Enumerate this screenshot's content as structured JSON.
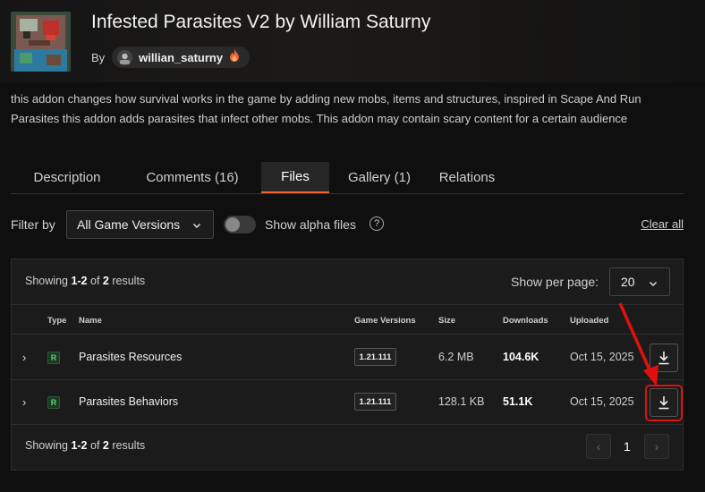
{
  "project": {
    "title": "Infested Parasites V2 by William Saturny",
    "by_label": "By",
    "author": "willian_saturny",
    "description": "this addon changes how survival works in the game by adding new mobs, items and structures, inspired in Scape And Run Parasites this addon adds parasites that infect other mobs. This addon may contain scary content for a certain audience"
  },
  "tabs": [
    {
      "label": "Description",
      "active": false
    },
    {
      "label": "Comments (16)",
      "active": false
    },
    {
      "label": "Files",
      "active": true
    },
    {
      "label": "Gallery (1)",
      "active": false
    },
    {
      "label": "Relations",
      "active": false
    }
  ],
  "filters": {
    "filter_label": "Filter by",
    "game_versions": "All Game Versions",
    "alpha_label": "Show alpha files",
    "alpha_enabled": false,
    "help_icon": "?",
    "clear_all": "Clear all"
  },
  "results": {
    "showing_prefix": "Showing",
    "range": "1-2",
    "of": "of",
    "total": "2",
    "suffix": "results",
    "per_page_label": "Show per page:",
    "per_page": "20"
  },
  "table": {
    "headers": {
      "type": "Type",
      "name": "Name",
      "versions": "Game Versions",
      "size": "Size",
      "downloads": "Downloads",
      "uploaded": "Uploaded"
    },
    "rows": [
      {
        "type": "R",
        "name": "Parasites Resources",
        "version": "1.21.111",
        "size": "6.2 MB",
        "downloads": "104.6K",
        "uploaded": "Oct 15, 2025"
      },
      {
        "type": "R",
        "name": "Parasites Behaviors",
        "version": "1.21.111",
        "size": "128.1 KB",
        "downloads": "51.1K",
        "uploaded": "Oct 15, 2025"
      }
    ]
  },
  "pagination": {
    "prev": "‹",
    "page": "1",
    "next": "›"
  },
  "colors": {
    "accent": "#f16436",
    "annotation": "#e01010",
    "release_badge": "#5cd07a"
  },
  "icons": {
    "download": "download-icon",
    "chevron": "chevron-down-icon",
    "expand": "chevron-right-icon",
    "fire": "fire-icon",
    "help": "help-circle-icon"
  }
}
